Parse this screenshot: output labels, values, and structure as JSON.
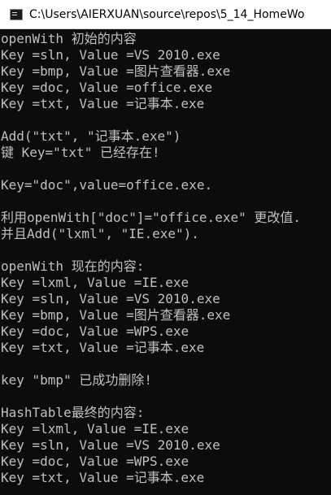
{
  "window": {
    "title": "C:\\Users\\AIERXUAN\\source\\repos\\5_14_HomeWo",
    "icon": "console-app-icon",
    "colors": {
      "titlebar_bg": "#ffffff",
      "console_bg": "#0c0c0c",
      "console_text": "#c0c0c0"
    }
  },
  "console": {
    "lines": [
      "openWith 初始的内容",
      "Key =sln, Value =VS 2010.exe",
      "Key =bmp, Value =图片查看器.exe",
      "Key =doc, Value =office.exe",
      "Key =txt, Value =记事本.exe",
      "",
      "Add(\"txt\", \"记事本.exe\")",
      "键 Key=\"txt\" 已经存在!",
      "",
      "Key=\"doc\",value=office.exe.",
      "",
      "利用openWith[\"doc\"]=\"office.exe\" 更改值.",
      "并且Add(\"lxml\", \"IE.exe\").",
      "",
      "openWith 现在的内容:",
      "Key =lxml, Value =IE.exe",
      "Key =sln, Value =VS 2010.exe",
      "Key =bmp, Value =图片查看器.exe",
      "Key =doc, Value =WPS.exe",
      "Key =txt, Value =记事本.exe",
      "",
      "key \"bmp\" 已成功删除!",
      "",
      "HashTable最终的内容:",
      "Key =lxml, Value =IE.exe",
      "Key =sln, Value =VS 2010.exe",
      "Key =doc, Value =WPS.exe",
      "Key =txt, Value =记事本.exe"
    ]
  }
}
